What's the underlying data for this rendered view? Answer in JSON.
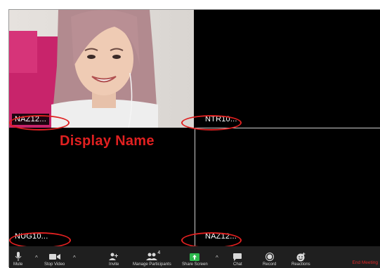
{
  "tiles": [
    {
      "name": "NAZ12..."
    },
    {
      "name": "NTR10..."
    },
    {
      "name": "NUG10..."
    },
    {
      "name": "NAZ12..."
    }
  ],
  "annotation": {
    "text": "Display Name",
    "color": "#e02020"
  },
  "toolbar": {
    "mute": "Mute",
    "stop_video": "Stop Video",
    "invite": "Invite",
    "manage_participants": "Manage Participants",
    "participants_count": "4",
    "share_screen": "Share Screen",
    "chat": "Chat",
    "record": "Record",
    "reactions": "Reactions",
    "end_meeting": "End Meeting"
  },
  "icons": [
    "microphone-icon",
    "video-camera-icon",
    "add-person-icon",
    "participants-icon",
    "share-screen-icon",
    "chat-icon",
    "record-icon",
    "reactions-icon",
    "caret-up-icon"
  ],
  "colors": {
    "accent_red": "#e02020",
    "share_green": "#2db84d",
    "toolbar_bg": "#1f1f1f"
  }
}
